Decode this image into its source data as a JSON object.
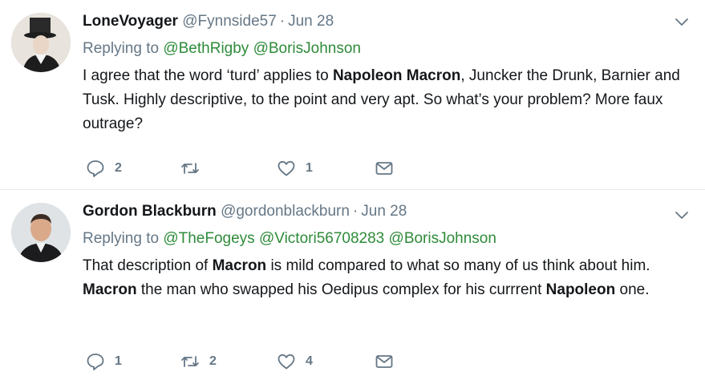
{
  "tweets": [
    {
      "name": "LoneVoyager",
      "handle": "@Fynnside57",
      "date": "Jun 28",
      "replying_prefix": "Replying to",
      "mentions": [
        "@BethRigby",
        "@BorisJohnson"
      ],
      "text_parts": [
        {
          "t": "I agree that the word ‘turd’ applies to ",
          "b": false
        },
        {
          "t": "Napoleon Macron",
          "b": true
        },
        {
          "t": ", Juncker the Drunk, Barnier and Tusk.  Highly descriptive, to the point and very apt. So what’s your problem? More faux outrage?",
          "b": false
        }
      ],
      "reply_count": "2",
      "retweet_count": "",
      "like_count": "1"
    },
    {
      "name": "Gordon Blackburn",
      "handle": "@gordonblackburn",
      "date": "Jun 28",
      "replying_prefix": "Replying to",
      "mentions": [
        "@TheFogeys",
        "@Victori56708283",
        "@BorisJohnson"
      ],
      "text_parts": [
        {
          "t": "That description of ",
          "b": false
        },
        {
          "t": "Macron",
          "b": true
        },
        {
          "t": " is mild compared to what so many of us think about him. ",
          "b": false
        },
        {
          "t": "Macron",
          "b": true
        },
        {
          "t": " the man who swapped his Oedipus complex for his currrent ",
          "b": false
        },
        {
          "t": "Napoleon",
          "b": true
        },
        {
          "t": " one.",
          "b": false
        }
      ],
      "reply_count": "1",
      "retweet_count": "2",
      "like_count": "4"
    }
  ],
  "icons": {
    "reply": "reply-icon",
    "retweet": "retweet-icon",
    "like": "heart-icon",
    "dm": "envelope-icon",
    "more": "chevron-down-icon"
  },
  "colors": {
    "mention": "#2e8b3a",
    "secondary_text": "#657786",
    "icon": "#657786",
    "divider": "#e6ecf0"
  }
}
